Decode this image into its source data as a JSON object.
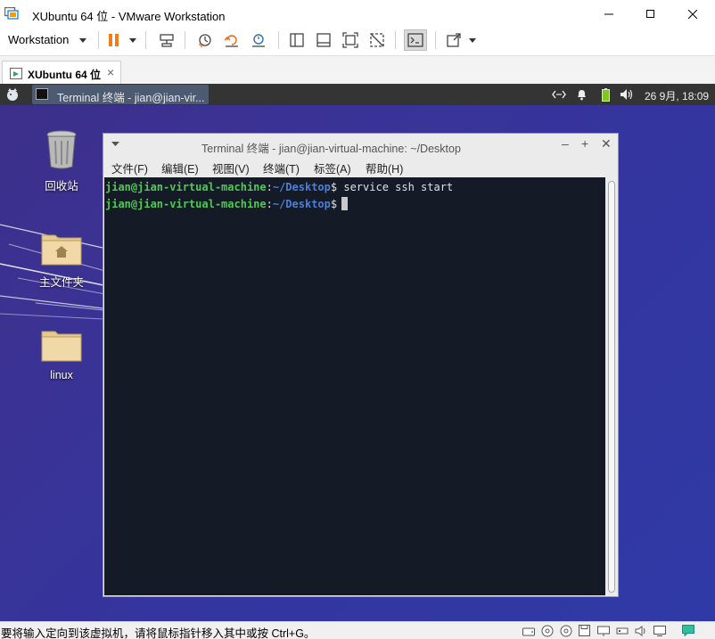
{
  "window": {
    "title": "XUbuntu 64 位 - VMware Workstation",
    "minimize_glyph": "–",
    "maximize_glyph": "□",
    "close_glyph": "✕"
  },
  "toolbar": {
    "workstation_label": "Workstation",
    "icons": [
      "pause-icon",
      "send-keys-icon",
      "snapshot-icon",
      "revert-snapshot-icon",
      "snapshot-manager-icon",
      "view-library-icon",
      "view-thumbnail-icon",
      "fullscreen-icon",
      "unity-icon",
      "console-view-icon",
      "stretch-icon"
    ]
  },
  "tabs": [
    {
      "label": "XUbuntu 64 位",
      "close_glyph": "×"
    }
  ],
  "guest": {
    "panel": {
      "task_label": "Terminal 终端 - jian@jian-vir...",
      "clock": "26 9月, 18:09"
    },
    "desktop_icons": [
      {
        "name": "trash",
        "label": "回收站"
      },
      {
        "name": "home-folder",
        "label": "主文件夹"
      },
      {
        "name": "linux-folder",
        "label": "linux"
      }
    ],
    "terminal": {
      "title": "Terminal 终端 - jian@jian-virtual-machine: ~/Desktop",
      "menu": [
        "文件(F)",
        "编辑(E)",
        "视图(V)",
        "终端(T)",
        "标签(A)",
        "帮助(H)"
      ],
      "lines": [
        {
          "user": "jian@jian-virtual-machine",
          "sep": ":",
          "path": "~/Desktop",
          "prompt": "$",
          "cmd": " service ssh start"
        },
        {
          "user": "jian@jian-virtual-machine",
          "sep": ":",
          "path": "~/Desktop",
          "prompt": "$",
          "cmd": ""
        }
      ]
    }
  },
  "status": {
    "text": "要将输入定向到该虚拟机，请将鼠标指针移入其中或按 Ctrl+G。",
    "icons": [
      "hard-disk-icon",
      "cd-dvd-icon",
      "cd-dvd-2-icon",
      "floppy-icon",
      "network-icon",
      "usb-icon",
      "sound-icon",
      "display-icon",
      "message-icon"
    ]
  },
  "colors": {
    "prompt_user": "#4ec954",
    "prompt_path": "#4b7fd8",
    "terminal_bg": "#141a26",
    "pause_orange": "#f07d17",
    "desktop": "#3a3396"
  }
}
